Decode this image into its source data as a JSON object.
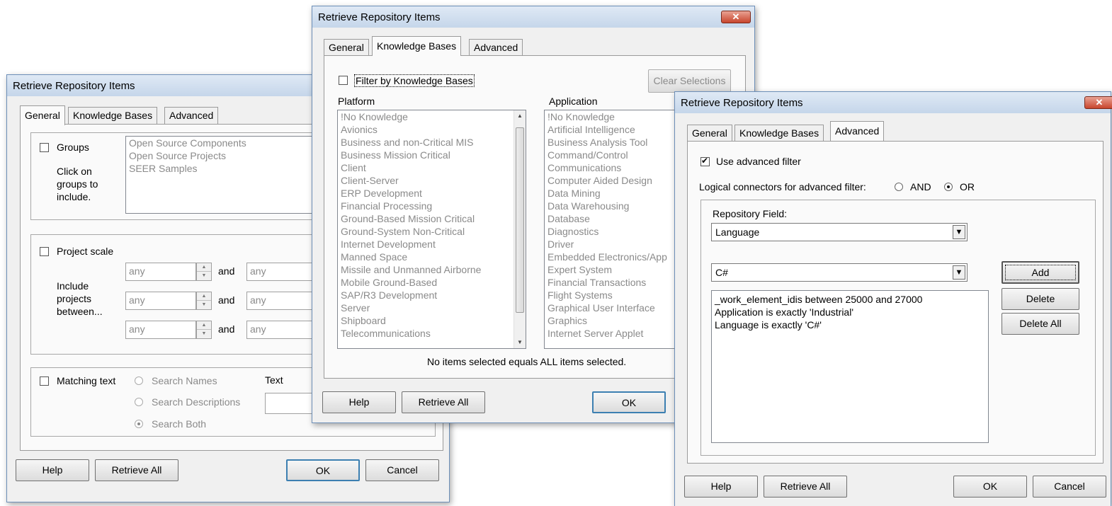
{
  "window1": {
    "title": "Retrieve Repository Items",
    "tabs": [
      "General",
      "Knowledge Bases",
      "Advanced"
    ],
    "groups_label": "Groups",
    "groups_hint": [
      "Click on",
      "groups to",
      "include."
    ],
    "groups_items": [
      "Open Source Components",
      "Open Source Projects",
      "SEER Samples"
    ],
    "project_scale_label": "Project scale",
    "include_label": [
      "Include",
      "projects",
      "between..."
    ],
    "range_rows": [
      {
        "from": "any",
        "and": "and",
        "to": "any"
      },
      {
        "from": "any",
        "and": "and",
        "to": "any"
      },
      {
        "from": "any",
        "and": "and",
        "to": "any"
      }
    ],
    "matching_text_label": "Matching text",
    "search_names": "Search Names",
    "search_descriptions": "Search Descriptions",
    "search_both": "Search Both",
    "text_label": "Text",
    "buttons": {
      "help": "Help",
      "retrieve_all": "Retrieve All",
      "ok": "OK",
      "cancel": "Cancel"
    }
  },
  "window2": {
    "title": "Retrieve Repository Items",
    "close": "✕",
    "tabs": [
      "General",
      "Knowledge Bases",
      "Advanced"
    ],
    "filter_label": "Filter by Knowledge Bases",
    "clear_selections": "Clear Selections",
    "platform_header": "Platform",
    "application_header": "Application",
    "platform_items": [
      "!No Knowledge",
      "Avionics",
      "Business and non-Critical MIS",
      "Business Mission Critical",
      "Client",
      "Client-Server",
      "ERP Development",
      "Financial Processing",
      "Ground-Based Mission Critical",
      "Ground-System Non-Critical",
      "Internet Development",
      "Manned Space",
      "Missile and Unmanned Airborne",
      "Mobile Ground-Based",
      "SAP/R3 Development",
      "Server",
      "Shipboard",
      "Telecommunications"
    ],
    "application_items": [
      "!No Knowledge",
      "Artificial Intelligence",
      "Business Analysis Tool",
      "Command/Control",
      "Communications",
      "Computer Aided Design",
      "Data Mining",
      "Data Warehousing",
      "Database",
      "Diagnostics",
      "Driver",
      "Embedded Electronics/App",
      "Expert System",
      "Financial Transactions",
      "Flight Systems",
      "Graphical User Interface",
      "Graphics",
      "Internet Server Applet"
    ],
    "note": "No items selected equals ALL items selected.",
    "buttons": {
      "help": "Help",
      "retrieve_all": "Retrieve All",
      "ok": "OK"
    }
  },
  "window3": {
    "title": "Retrieve Repository Items",
    "close": "✕",
    "tabs": [
      "General",
      "Knowledge Bases",
      "Advanced"
    ],
    "use_advanced_filter": "Use advanced filter",
    "logical_connectors_label": "Logical connectors for advanced filter:",
    "and_label": "AND",
    "or_label": "OR",
    "repository_field_label": "Repository Field:",
    "repository_field_value": "Language",
    "value_combo": "C#",
    "filter_items": [
      "_work_element_idis between 25000 and 27000",
      "Application is exactly 'Industrial'",
      "Language is exactly 'C#'"
    ],
    "side_buttons": {
      "add": "Add",
      "delete": "Delete",
      "delete_all": "Delete All"
    },
    "buttons": {
      "help": "Help",
      "retrieve_all": "Retrieve All",
      "ok": "OK",
      "cancel": "Cancel"
    }
  }
}
